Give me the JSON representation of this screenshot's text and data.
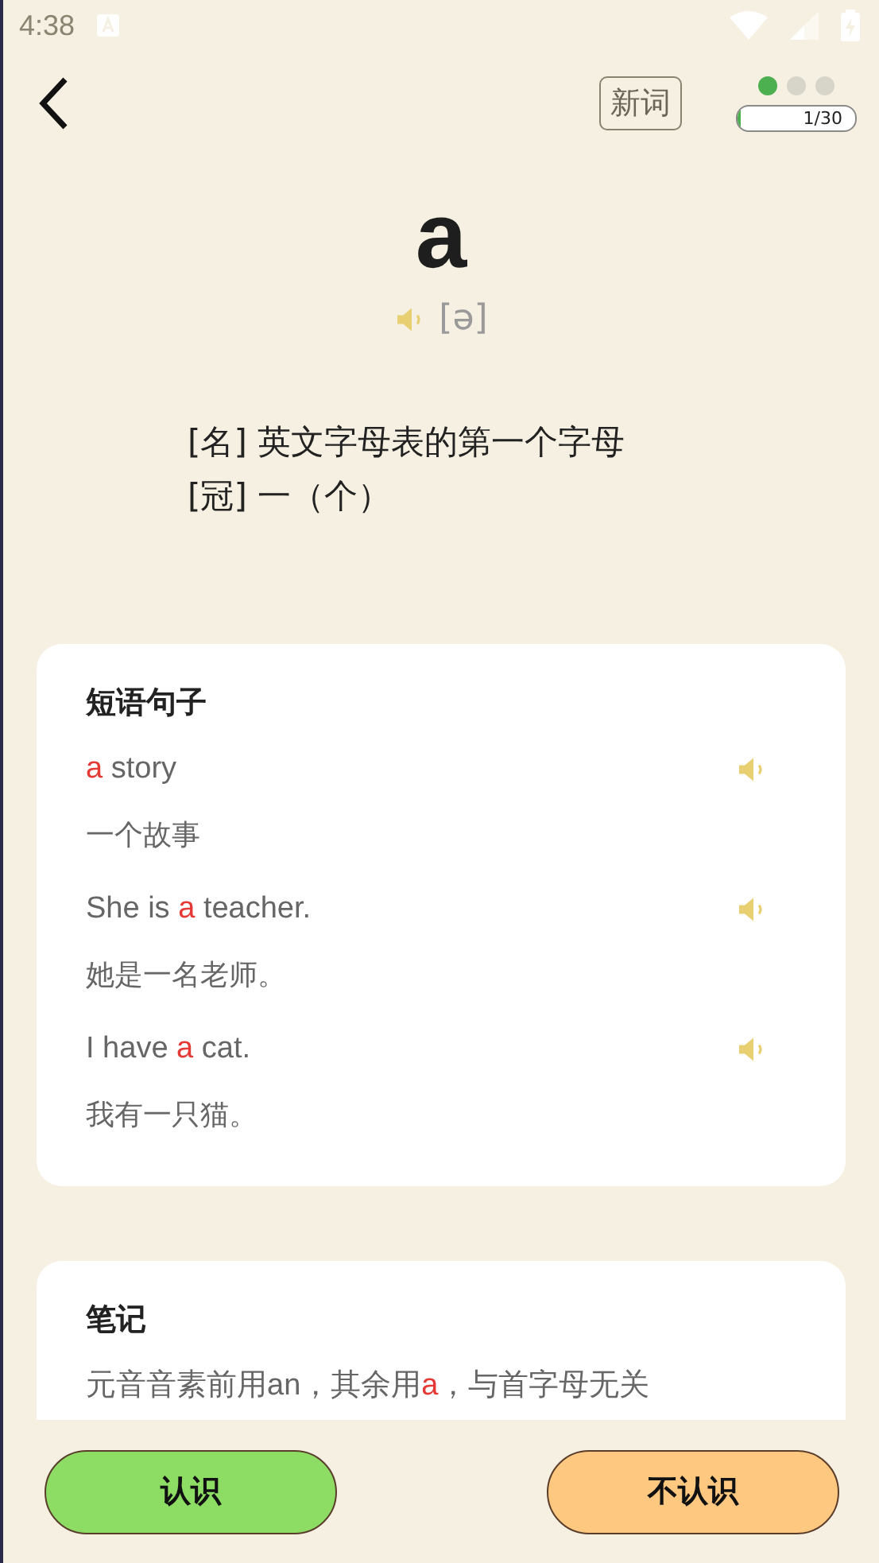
{
  "status_bar": {
    "time": "4:38"
  },
  "header": {
    "tag": "新词",
    "dots": [
      {
        "selected": true
      },
      {
        "selected": false
      },
      {
        "selected": false
      }
    ],
    "progress": {
      "level": 0.0333,
      "reading": "1/30"
    }
  },
  "word": {
    "text": "a",
    "phonetic": "[ə]",
    "definitions": [
      "[名] 英文字母表的第一个字母",
      "[冠] 一（个）"
    ]
  },
  "phrases": {
    "title": "短语句子",
    "items": [
      {
        "sentence": [
          {
            "text": "a",
            "highlight": true
          },
          {
            "text": " story",
            "highlight": false
          }
        ],
        "translation": "一个故事"
      },
      {
        "sentence": [
          {
            "text": "She is ",
            "highlight": false
          },
          {
            "text": "a",
            "highlight": true
          },
          {
            "text": " teacher.",
            "highlight": false
          }
        ],
        "translation": "她是一名老师。"
      },
      {
        "sentence": [
          {
            "text": "I have ",
            "highlight": false
          },
          {
            "text": "a",
            "highlight": true
          },
          {
            "text": " cat.",
            "highlight": false
          }
        ],
        "translation": "我有一只猫。"
      }
    ]
  },
  "notes": {
    "title": "笔记",
    "text": [
      {
        "text": "元音音素前用an，其余用",
        "highlight": false
      },
      {
        "text": "a",
        "highlight": true
      },
      {
        "text": "，与首字母无关",
        "highlight": false
      }
    ]
  },
  "buttons": [
    {
      "label": "认识",
      "kind": "know"
    },
    {
      "label": "不认识",
      "kind": "unknown"
    }
  ]
}
